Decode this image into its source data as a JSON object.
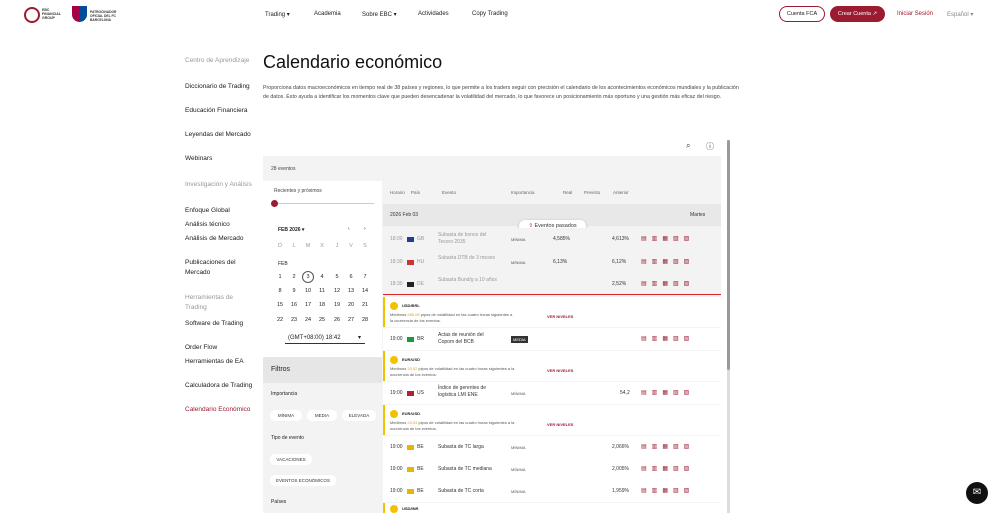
{
  "header": {
    "logo_text": "EBC FINANCIAL GROUP",
    "partner_text": "PATROCINADOR OFICIAL DEL FC BARCELONA",
    "nav": [
      "Trading",
      "Academia",
      "Sobre EBC",
      "Actividades",
      "Copy Trading"
    ],
    "cuenta_fca": "Cuenta FCA",
    "crear_cuenta": "Crear Cuenta ↗",
    "login": "Iniciar Sesión",
    "lang": "Español"
  },
  "sidebar": {
    "sections": [
      {
        "heading": "Centro de Aprendizaje",
        "items": [
          "Diccionario de Trading",
          "Educación Financiera",
          "Leyendas del Mercado",
          "Webinars"
        ]
      },
      {
        "heading": "Investigación y Análisis",
        "items": [
          "Enfoque Global",
          "Análisis técnico",
          "Análisis de Mercado",
          "Publicaciones del Mercado"
        ]
      },
      {
        "heading": "Herramientas de Trading",
        "items": [
          "Software de Trading",
          "Order Flow",
          "Herramientas de EA",
          "Calculadora de Trading",
          "Calendario Económico"
        ]
      }
    ]
  },
  "main": {
    "title": "Calendario económico",
    "description": "Proporciona datos macroeconómicos en tiempo real de 38 países y regiones, lo que permite a los traders seguir con precisión el calendario de los acontecimientos económicos mundiales y la publicación de datos. Esto ayuda a identificar los momentos clave que pueden desencadenar la volatilidad del mercado, lo que favorece un posicionamiento más oportuno y una gestión más eficaz del riesgo."
  },
  "widget": {
    "events_count": "28 eventos",
    "range_label": "Recientes y próximos",
    "month": "FEB 2026",
    "weekdays": [
      "D",
      "L",
      "M",
      "X",
      "J",
      "V",
      "S"
    ],
    "month_short": "FEB",
    "days": [
      [
        "1",
        "2",
        "3",
        "4",
        "5",
        "6",
        "7"
      ],
      [
        "8",
        "9",
        "10",
        "11",
        "12",
        "13",
        "14"
      ],
      [
        "15",
        "16",
        "17",
        "18",
        "19",
        "20",
        "21"
      ],
      [
        "22",
        "23",
        "24",
        "25",
        "26",
        "27",
        "28"
      ]
    ],
    "timezone": "(GMT+08:00) 18:42",
    "filters": "Filtros",
    "importance": "Importancia",
    "importance_opts": [
      "MÍNIMA",
      "MEDIA",
      "ELEVADA"
    ],
    "event_type": "Tipo de evento",
    "event_types": [
      "VACACIONES",
      "EVENTOS ECONÓMICOS"
    ],
    "countries": "Países",
    "columns": [
      "Horario",
      "País",
      "Evento",
      "Importancia",
      "Real",
      "Previsto",
      "Anterior"
    ],
    "date": "2026 Feb 03",
    "weekday": "Martes",
    "past_events": "Eventos pasados",
    "rows": [
      {
        "time": "18:00",
        "country": "GB",
        "event": "Subasta de bonos del Tesoro 2035",
        "impact": "MÍNIMA",
        "real": "4,585%",
        "prev": "",
        "ant": "4,613%"
      },
      {
        "time": "18:30",
        "country": "HU",
        "event": "Subasta DTB de 3 meses",
        "impact": "MÍNIMA",
        "real": "6,13%",
        "prev": "",
        "ant": "6,12%"
      },
      {
        "time": "18:30",
        "country": "DE",
        "event": "Subasta Bund/g a 10 años",
        "impact": "",
        "real": "",
        "prev": "",
        "ant": "2,52%"
      }
    ],
    "vol1": {
      "pair": "USD/BRL",
      "text_a": "Medimos",
      "pips": "585.08",
      "text_b": "pipos de volatilidad en las cuatro horas siguientes a la ocurrencia de los eventos.",
      "link": "VER NIVELES"
    },
    "row_bcb": {
      "time": "19:00",
      "country": "BR",
      "event": "Actas de reunión del Copom del BCB",
      "impact": "MEDIA"
    },
    "vol2": {
      "pair": "EUR/USD",
      "text_a": "Medimos",
      "pips": "33.52",
      "text_b": "pipos de volatilidad en las cuatro horas siguientes a la ocurrencia de los eventos.",
      "link": "VER NIVELES"
    },
    "row_us": {
      "time": "19:00",
      "country": "US",
      "event": "Índice de gerentes de logística LMI ENE",
      "impact": "MÍNIMA",
      "ant": "54,2"
    },
    "vol3": {
      "pair": "EUR/USD",
      "text_a": "Medimos",
      "pips": "25.53",
      "text_b": "pipos de volatilidad en las cuatro horas siguientes a la ocurrencia de los eventos.",
      "link": "VER NIVELES"
    },
    "rows_be": [
      {
        "time": "19:00",
        "country": "BE",
        "event": "Subasta de TC larga",
        "impact": "MÍNIMA",
        "ant": "2,066%"
      },
      {
        "time": "19:00",
        "country": "BE",
        "event": "Subasta de TC mediana",
        "impact": "MÍNIMA",
        "ant": "2,005%"
      },
      {
        "time": "19:00",
        "country": "BE",
        "event": "Subasta de TC corta",
        "impact": "MÍNIMA",
        "ant": "1,959%"
      }
    ],
    "vol4_pair": "USD/INR"
  }
}
